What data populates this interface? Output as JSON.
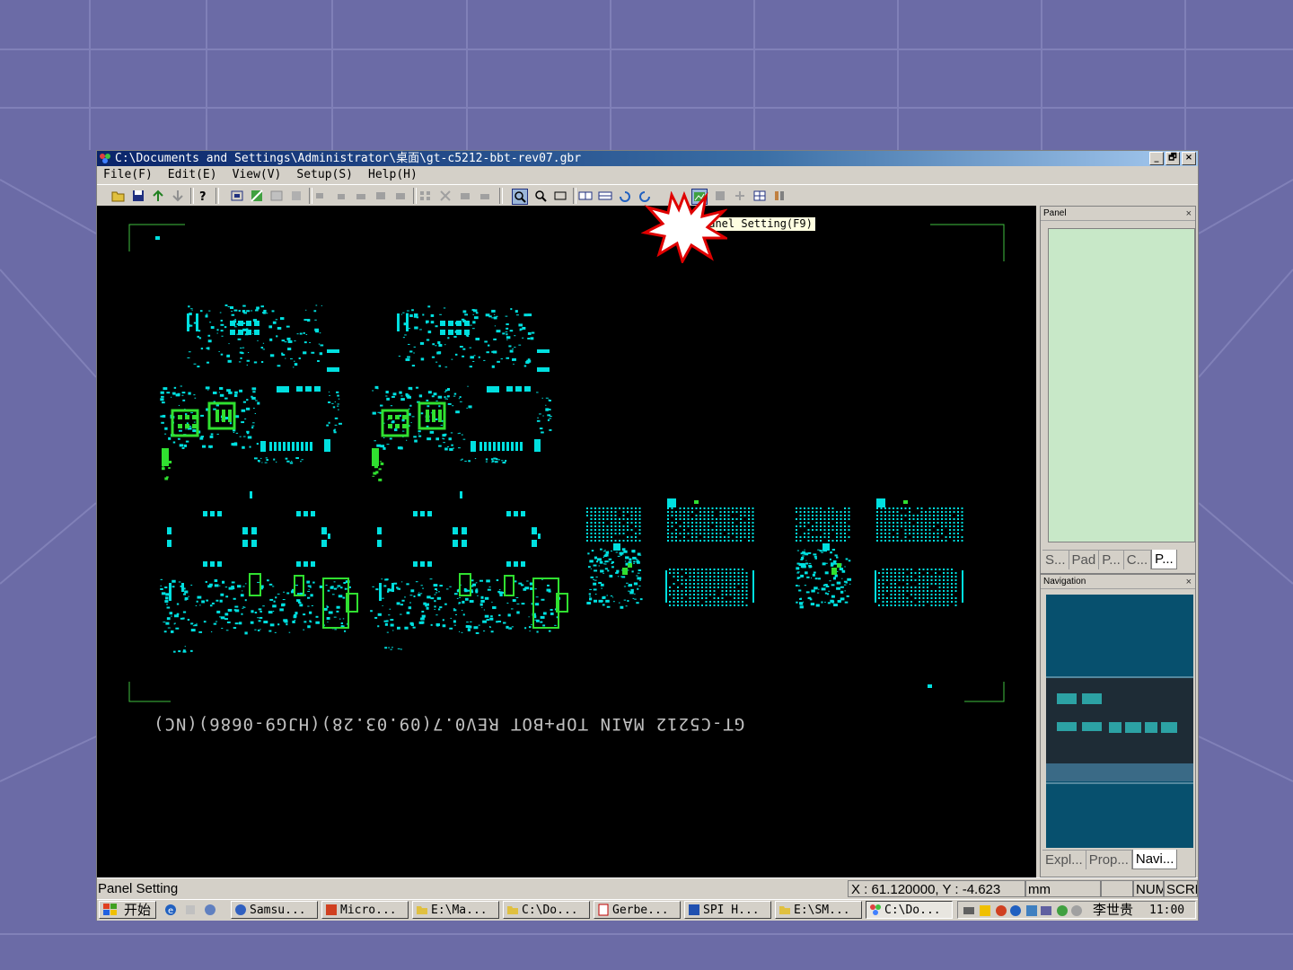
{
  "window": {
    "title": "C:\\Documents and Settings\\Administrator\\桌面\\gt-c5212-bbt-rev07.gbr",
    "controls": [
      "_",
      "🗗",
      "×"
    ]
  },
  "menubar": {
    "items": [
      {
        "label": "File(F)"
      },
      {
        "label": "Edit(E)"
      },
      {
        "label": "View(V)"
      },
      {
        "label": "Setup(S)"
      },
      {
        "label": "Help(H)"
      }
    ]
  },
  "toolbar": {
    "tooltip": "Panel Setting(F9)",
    "icons": [
      "open-icon",
      "save-icon",
      "import-icon",
      "export-icon",
      "help-icon",
      "select-all-icon",
      "edit-icon",
      "copy-icon",
      "paste-icon",
      "align-icon",
      "move-icon",
      "mirror-icon",
      "rotate-icon",
      "array-icon",
      "delete-icon",
      "group-icon",
      "merge-icon",
      "zoom-in-icon",
      "zoom-out-icon",
      "zoom-fit-icon",
      "view-h-icon",
      "view-v-icon",
      "undo-icon",
      "redo-icon",
      "panel-setting-icon",
      "disabled-icon",
      "cross-icon",
      "grid-icon",
      "tools-icon"
    ]
  },
  "canvas": {
    "board_text": "GT-C5212 MAIN TOP+BOT REV0.7(09.03.28)(HJG9-0686)(NC)",
    "background": "#000000",
    "pad_color": "#00e0e0",
    "highlight_color": "#30e030"
  },
  "panel": {
    "title": "Panel",
    "close": "×",
    "tabs": [
      {
        "label": "S..."
      },
      {
        "label": "Pad"
      },
      {
        "label": "P..."
      },
      {
        "label": "C..."
      },
      {
        "label": "P...",
        "active": true
      }
    ]
  },
  "navigation": {
    "title": "Navigation",
    "close": "×",
    "tabs": [
      {
        "label": "Expl..."
      },
      {
        "label": "Prop..."
      },
      {
        "label": "Navi...",
        "active": true
      }
    ]
  },
  "statusbar": {
    "left": "Panel Setting",
    "coords": "X : 61.120000, Y : -4.623",
    "unit": "mm",
    "num": "NUM",
    "scrl": "SCRL"
  },
  "taskbar": {
    "start": "开始",
    "tasks": [
      {
        "label": "Samsu..."
      },
      {
        "label": "Micro..."
      },
      {
        "label": "E:\\Ma..."
      },
      {
        "label": "C:\\Do..."
      },
      {
        "label": "Gerbe..."
      },
      {
        "label": "SPI H..."
      },
      {
        "label": "E:\\SM..."
      },
      {
        "label": "C:\\Do...",
        "active": true
      }
    ],
    "user": "李世贵",
    "time": "11:00"
  }
}
